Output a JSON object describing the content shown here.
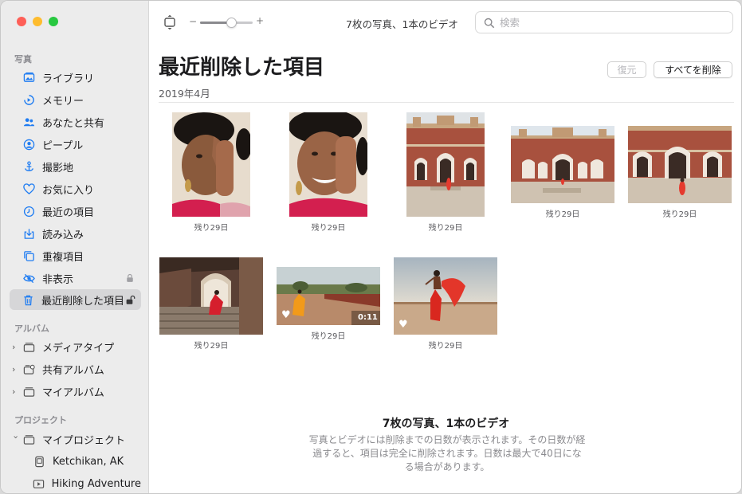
{
  "window": {
    "title": "写真"
  },
  "sidebar": {
    "sections": {
      "photos": "写真",
      "albums": "アルバム",
      "projects": "プロジェクト"
    },
    "items": [
      {
        "label": "ライブラリ",
        "icon": "library-icon"
      },
      {
        "label": "メモリー",
        "icon": "memories-icon"
      },
      {
        "label": "あなたと共有",
        "icon": "shared-with-you-icon"
      },
      {
        "label": "ピープル",
        "icon": "people-icon"
      },
      {
        "label": "撮影地",
        "icon": "places-icon"
      },
      {
        "label": "お気に入り",
        "icon": "heart-icon"
      },
      {
        "label": "最近の項目",
        "icon": "clock-icon"
      },
      {
        "label": "読み込み",
        "icon": "import-icon"
      },
      {
        "label": "重複項目",
        "icon": "duplicates-icon"
      },
      {
        "label": "非表示",
        "icon": "hidden-eye-icon"
      },
      {
        "label": "最近削除した項目",
        "icon": "trash-icon"
      }
    ],
    "albums": [
      {
        "label": "メディアタイプ"
      },
      {
        "label": "共有アルバム"
      },
      {
        "label": "マイアルバム"
      }
    ],
    "projects": [
      {
        "label": "マイプロジェクト"
      },
      {
        "label": "Ketchikan, AK"
      },
      {
        "label": "Hiking Adventure"
      }
    ]
  },
  "toolbar": {
    "zoom_minus": "−",
    "zoom_plus": "+",
    "zoom_level": 0.62,
    "count_label": "7枚の写真、1本のビデオ",
    "search_placeholder": "検索"
  },
  "main": {
    "title": "最近削除した項目",
    "recover_label": "復元",
    "delete_all_label": "すべてを削除",
    "date_header": "2019年4月",
    "items": [
      {
        "days": "残り29日",
        "favorite": false
      },
      {
        "days": "残り29日",
        "favorite": false
      },
      {
        "days": "残り29日",
        "favorite": false
      },
      {
        "days": "残り29日",
        "favorite": false
      },
      {
        "days": "残り29日",
        "favorite": false
      },
      {
        "days": "残り29日",
        "favorite": false
      },
      {
        "days": "残り29日",
        "favorite": true,
        "duration": "0:11"
      },
      {
        "days": "残り29日",
        "favorite": true
      }
    ],
    "summary_title": "7枚の写真、1本のビデオ",
    "summary_text": "写真とビデオには削除までの日数が表示されます。その日数が経過すると、項目は完全に削除されます。日数は最大で40日になる場合があります。"
  },
  "colors": {
    "accent": "#1e7cf2",
    "sidebar_bg": "#ececec",
    "selected_bg": "#d6d6d8"
  }
}
